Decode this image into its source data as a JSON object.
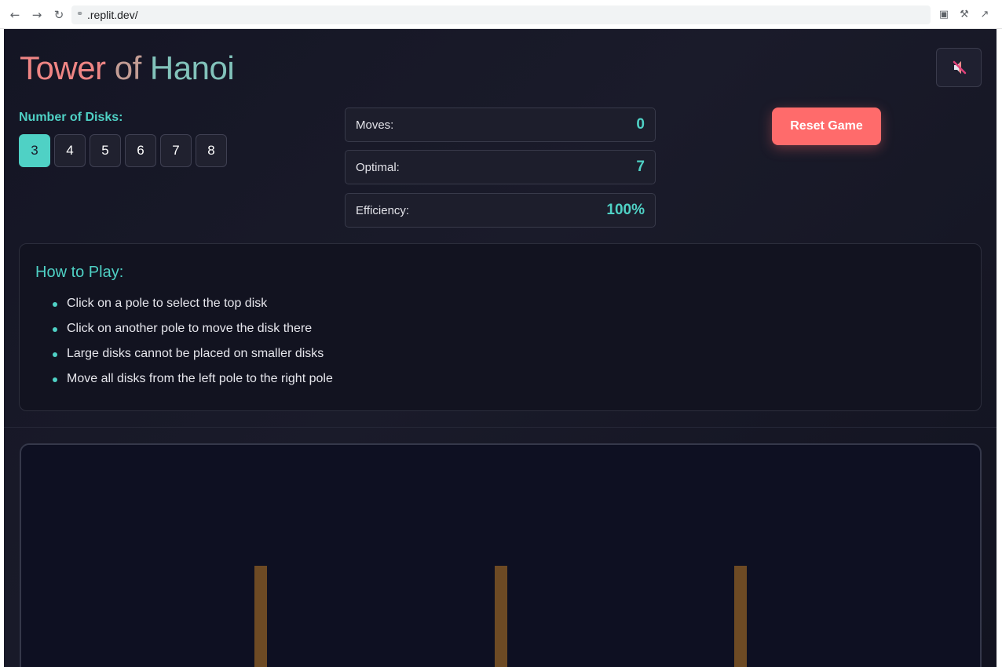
{
  "browser": {
    "url": ".replit.dev/",
    "icons": [
      "back-icon",
      "forward-icon",
      "reload-icon",
      "link-icon",
      "devices-icon",
      "wrench-icon",
      "open-external-icon"
    ]
  },
  "header": {
    "title_parts": [
      "Tower",
      "of",
      "Hanoi"
    ],
    "sound_icon": "speaker-muted-icon"
  },
  "disk_selector": {
    "label": "Number of Disks:",
    "options": [
      "3",
      "4",
      "5",
      "6",
      "7",
      "8"
    ],
    "selected": "3"
  },
  "stats": {
    "moves_label": "Moves:",
    "moves_value": "0",
    "optimal_label": "Optimal:",
    "optimal_value": "7",
    "efficiency_label": "Efficiency:",
    "efficiency_value": "100%"
  },
  "reset_label": "Reset Game",
  "how_to": {
    "title": "How to Play:",
    "items": [
      "Click on a pole to select the top disk",
      "Click on another pole to move the disk there",
      "Large disks cannot be placed on smaller disks",
      "Move all disks from the left pole to the right pole"
    ]
  },
  "colors": {
    "accent": "#4fd1c5",
    "reset": "#ff6b6b",
    "pole": "#6d4a24",
    "background": "#141524"
  }
}
